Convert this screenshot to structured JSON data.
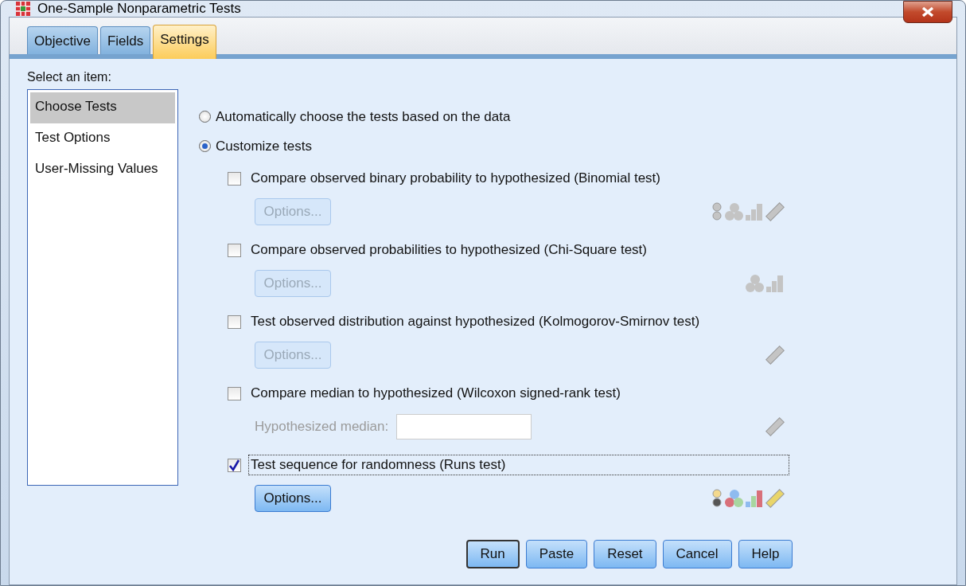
{
  "window": {
    "title": "One-Sample Nonparametric Tests"
  },
  "tabs": [
    {
      "label": "Objective",
      "selected": false
    },
    {
      "label": "Fields",
      "selected": false
    },
    {
      "label": "Settings",
      "selected": true
    }
  ],
  "sidebar": {
    "label": "Select an item:",
    "items": [
      {
        "label": "Choose Tests",
        "selected": true
      },
      {
        "label": "Test Options",
        "selected": false
      },
      {
        "label": "User-Missing Values",
        "selected": false
      }
    ]
  },
  "mode": [
    {
      "label": "Automatically choose the tests based on the data",
      "selected": false
    },
    {
      "label": "Customize tests",
      "selected": true
    }
  ],
  "tests": [
    {
      "label": "Compare observed binary probability to hypothesized (Binomial test)",
      "checked": false,
      "focused": false,
      "options": {
        "label": "Options...",
        "disabled": true
      },
      "measures": [
        {
          "kind": "binary"
        },
        {
          "kind": "nominal"
        },
        {
          "kind": "ordinal"
        },
        {
          "kind": "scale"
        }
      ]
    },
    {
      "label": "Compare observed probabilities to hypothesized (Chi-Square test)",
      "checked": false,
      "focused": false,
      "options": {
        "label": "Options...",
        "disabled": true
      },
      "measures": [
        {
          "kind": "nominal"
        },
        {
          "kind": "ordinal"
        }
      ]
    },
    {
      "label": "Test observed distribution against hypothesized (Kolmogorov-Smirnov test)",
      "checked": false,
      "focused": false,
      "options": {
        "label": "Options...",
        "disabled": true
      },
      "measures": [
        {
          "kind": "scale"
        }
      ]
    },
    {
      "label": "Compare median to hypothesized (Wilcoxon signed-rank test)",
      "checked": false,
      "focused": false,
      "field": {
        "label": "Hypothesized median:",
        "disabled": true
      },
      "measures": [
        {
          "kind": "scale"
        }
      ]
    },
    {
      "label": "Test sequence for randomness (Runs test)",
      "checked": true,
      "focused": true,
      "options": {
        "label": "Options...",
        "disabled": false
      },
      "measures": [
        {
          "kind": "binary"
        },
        {
          "kind": "nominal"
        },
        {
          "kind": "ordinal"
        },
        {
          "kind": "scale"
        }
      ]
    }
  ],
  "buttons": [
    {
      "label": "Run",
      "default": true
    },
    {
      "label": "Paste",
      "default": false
    },
    {
      "label": "Reset",
      "default": false
    },
    {
      "label": "Cancel",
      "default": false
    },
    {
      "label": "Help",
      "default": false
    }
  ]
}
